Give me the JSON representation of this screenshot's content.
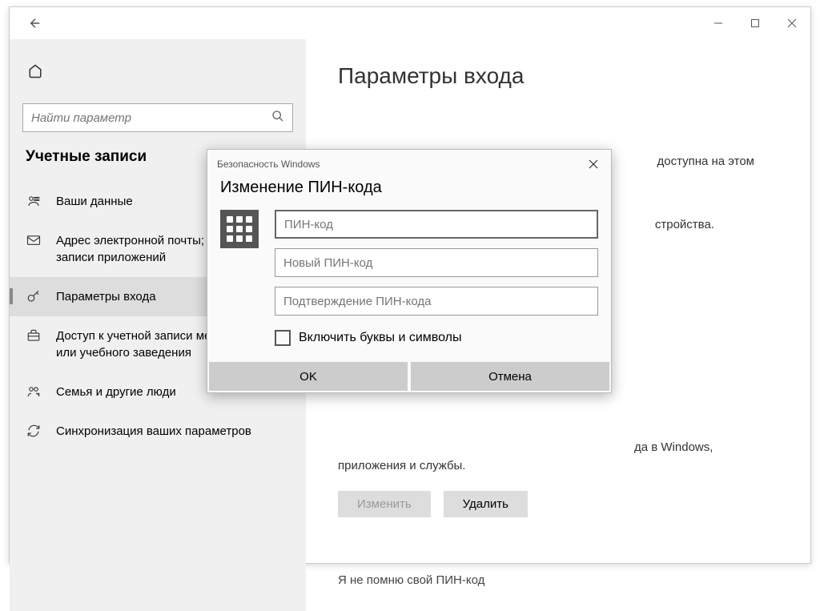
{
  "search": {
    "placeholder": "Найти параметр"
  },
  "section_title": "Учетные записи",
  "nav": [
    {
      "label": "Ваши данные",
      "icon": "user"
    },
    {
      "label": "Адрес электронной почты; учетные записи приложений",
      "icon": "mail"
    },
    {
      "label": "Параметры входа",
      "icon": "key",
      "active": true
    },
    {
      "label": "Доступ к учетной записи места работы или учебного заведения",
      "icon": "briefcase"
    },
    {
      "label": "Семья и другие люди",
      "icon": "family"
    },
    {
      "label": "Синхронизация ваших параметров",
      "icon": "sync"
    }
  ],
  "main": {
    "title": "Параметры входа",
    "text_top_fragment_1": "доступна на этом",
    "text_top_fragment_2": "стройства.",
    "text_bottom": "да в Windows, приложения и службы.",
    "change_btn": "Изменить",
    "delete_btn": "Удалить",
    "forgot_link": "Я не помню свой ПИН-код"
  },
  "dialog": {
    "header": "Безопасность Windows",
    "title": "Изменение ПИН-кода",
    "pin_current": "ПИН-код",
    "pin_new": "Новый ПИН-код",
    "pin_confirm": "Подтверждение ПИН-кода",
    "checkbox_label": "Включить буквы и символы",
    "ok": "OK",
    "cancel": "Отмена"
  }
}
